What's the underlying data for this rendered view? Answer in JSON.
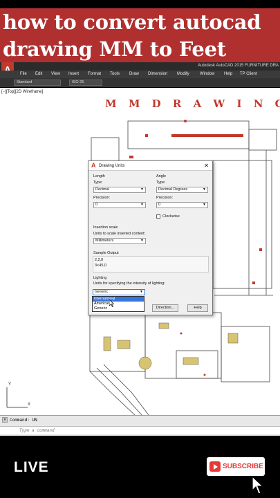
{
  "banner": {
    "line1": "how to convert autocad",
    "line2": "drawing MM to Feet"
  },
  "app": {
    "logo": "A",
    "title": "Autodesk AutoCAD 2015    FURNITURE DRA"
  },
  "menu": [
    "File",
    "Edit",
    "View",
    "Insert",
    "Format",
    "Tools",
    "Draw",
    "Dimension",
    "Modify",
    "Window",
    "Help",
    "TP Client"
  ],
  "toolbar": {
    "style": "Standard",
    "dimstyle": "ISO-25"
  },
  "viewport": {
    "label": "[−][Top][2D Wireframe]"
  },
  "drawing": {
    "heading": "M M   D R A W I N G"
  },
  "dialog": {
    "title": "Drawing Units",
    "length": {
      "heading": "Length",
      "type_label": "Type:",
      "type_value": "Decimal",
      "precision_label": "Precision:",
      "precision_value": "0"
    },
    "angle": {
      "heading": "Angle",
      "type_label": "Type:",
      "type_value": "Decimal Degrees",
      "precision_label": "Precision:",
      "precision_value": "0",
      "clockwise_label": "Clockwise"
    },
    "insertion": {
      "heading": "Insertion scale",
      "desc": "Units to scale inserted content:",
      "value": "Millimeters"
    },
    "sample": {
      "heading": "Sample Output",
      "line1": "2,2,0",
      "line2": "3<45,0"
    },
    "lighting": {
      "heading": "Lighting",
      "desc": "Units for specifying the intensity of lighting:",
      "value": "Generic",
      "options": [
        "International",
        "American",
        "Generic"
      ]
    },
    "buttons": {
      "direction": "Direction...",
      "help": "Help"
    }
  },
  "command": {
    "history": "Command: UN",
    "placeholder": "Type a command"
  },
  "overlay": {
    "live": "LIVE",
    "subscribe": "SUBSCRIBE"
  }
}
